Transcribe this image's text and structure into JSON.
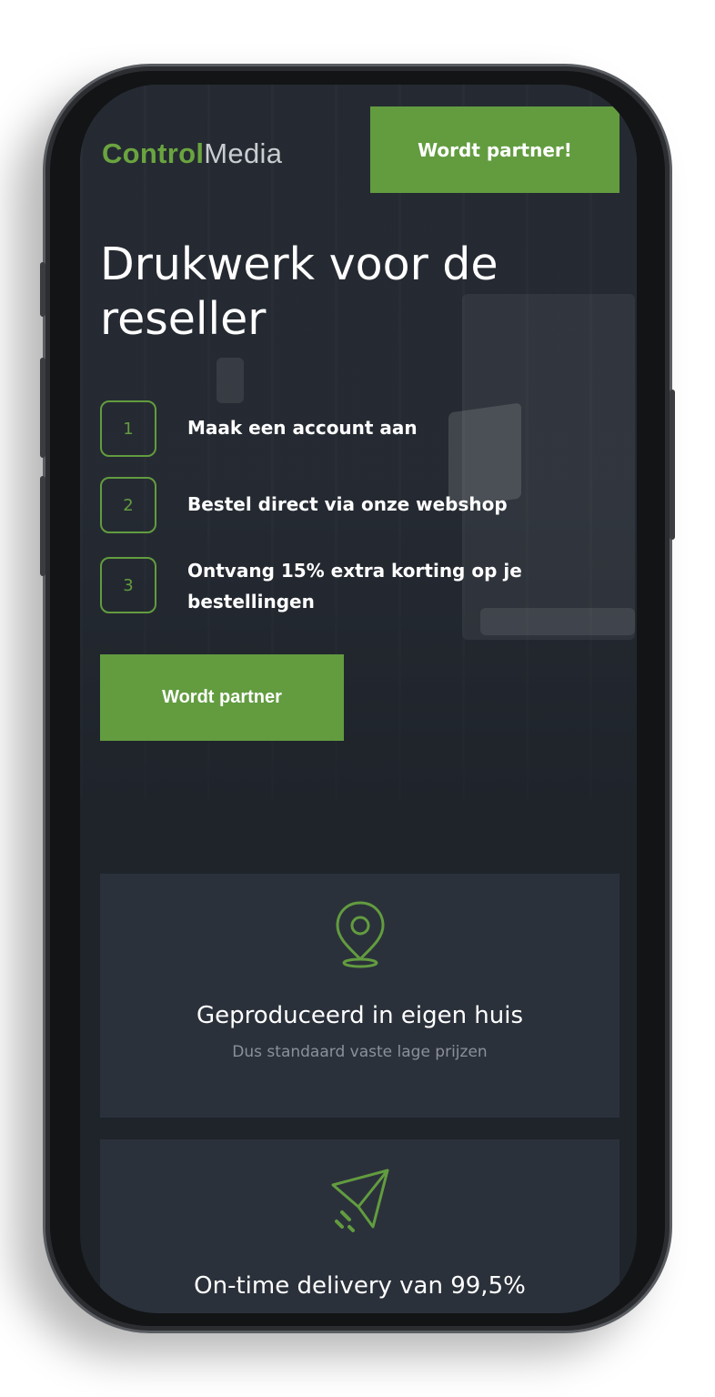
{
  "brand": {
    "part1": "Control",
    "part2": "Media"
  },
  "header": {
    "cta_label": "Wordt partner!"
  },
  "hero": {
    "title": "Drukwerk voor de reseller",
    "steps": [
      {
        "number": "1",
        "text": "Maak een account aan"
      },
      {
        "number": "2",
        "text": "Bestel direct via onze webshop"
      },
      {
        "number": "3",
        "text": "Ontvang 15% extra korting op je bestellingen"
      }
    ],
    "cta_label": "Wordt partner"
  },
  "features": [
    {
      "icon": "location-pin-icon",
      "title": "Geproduceerd in eigen huis",
      "subtitle": "Dus standaard vaste lage prijzen"
    },
    {
      "icon": "paper-plane-icon",
      "title": "On-time delivery van 99,5%"
    }
  ],
  "colors": {
    "accent": "#629c3f",
    "brand_green": "#6aa43f",
    "background": "#1f242b",
    "card": "#2b313b",
    "muted_text": "#8b9099"
  }
}
